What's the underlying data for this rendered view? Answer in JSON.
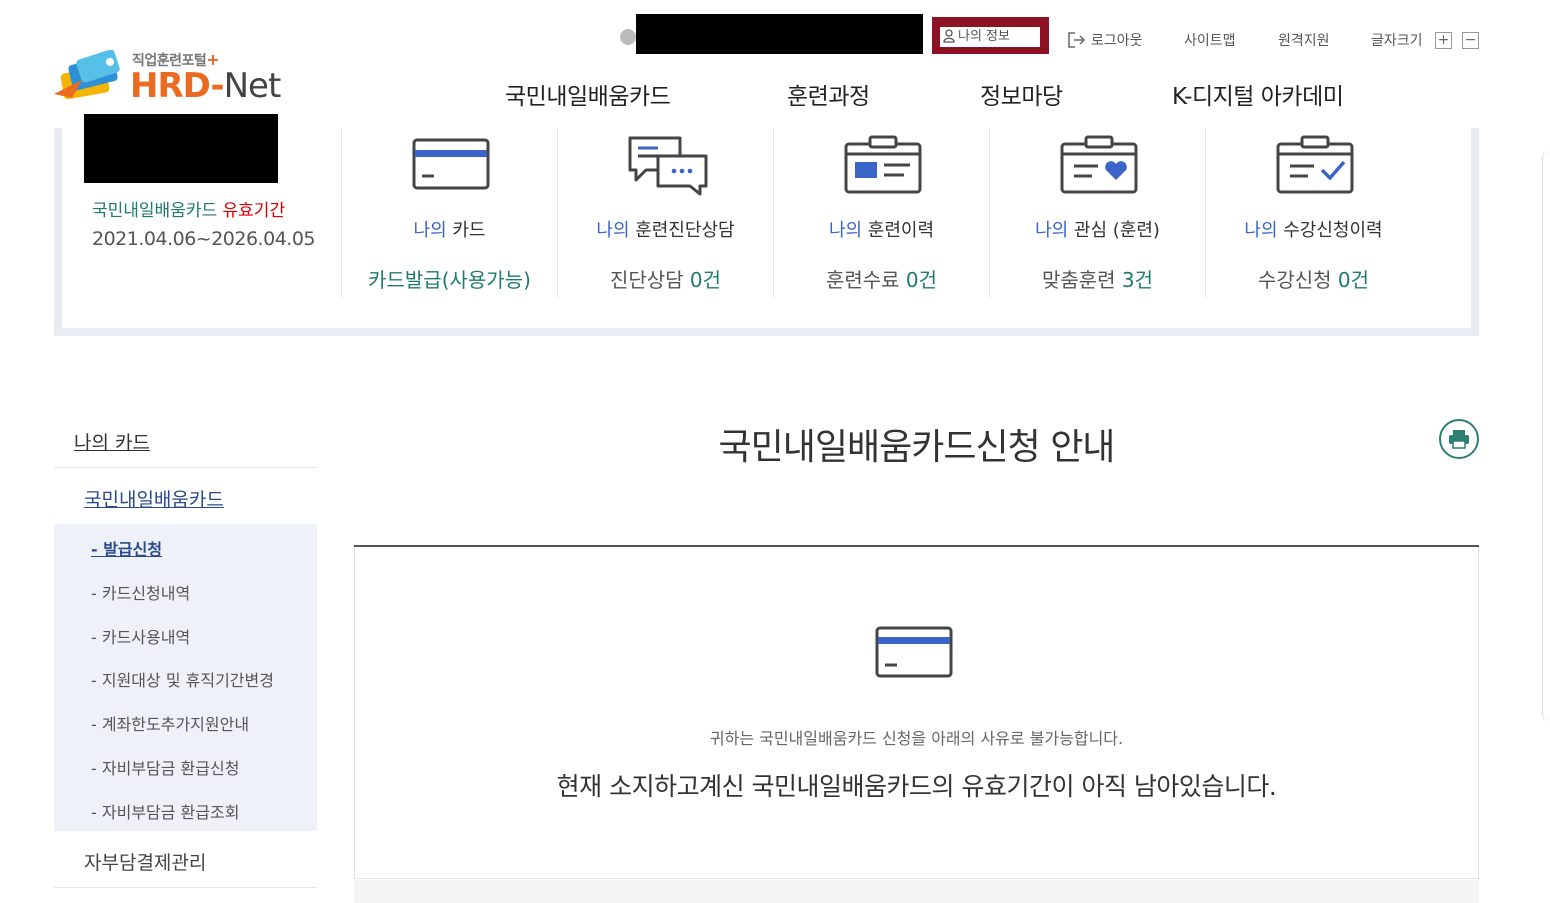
{
  "logo": {
    "sub_text": "직업훈련포털",
    "sub_plus": "+",
    "main_hrd": "HRD",
    "main_dash": "-",
    "main_net": "Net"
  },
  "util": {
    "my_info": "나의 정보",
    "logout": "로그아웃",
    "sitemap": "사이트맵",
    "remote": "원격지원",
    "font_size": "글자크기",
    "font_plus": "+",
    "font_minus": "−"
  },
  "gnb": [
    "국민내일배움카드",
    "훈련과정",
    "정보마당",
    "K-디지털 아카데미"
  ],
  "summary": {
    "validity_label_a": "국민내일배움카드 ",
    "validity_label_b": "유효기간",
    "validity_dates": "2021.04.06~2026.04.05",
    "columns": [
      {
        "my": "나의",
        "title": " 카드",
        "value": "카드발급(사용가능)",
        "icon": "credit-card-icon"
      },
      {
        "my": "나의",
        "title": " 훈련진단상담",
        "value_text": "진단상담 ",
        "value_num": "0건",
        "icon": "chat-bubbles-icon"
      },
      {
        "my": "나의",
        "title": " 훈련이력",
        "value_text": "훈련수료 ",
        "value_num": "0건",
        "icon": "id-card-icon"
      },
      {
        "my": "나의",
        "title": " 관심 (훈련)",
        "value_text": "맞춤훈련 ",
        "value_num": "3건",
        "icon": "heart-folder-icon"
      },
      {
        "my": "나의",
        "title": " 수강신청이력",
        "value_text": "수강신청 ",
        "value_num": "0건",
        "icon": "check-folder-icon"
      }
    ]
  },
  "sidebar": {
    "title": "나의 카드",
    "sub_title": "국민내일배움카드",
    "items": [
      "- 발급신청",
      "- 카드신청내역",
      "- 카드사용내역",
      "- 지원대상 및 휴직기간변경",
      "- 계좌한도추가지원안내",
      "- 자비부담금 환급신청",
      "- 자비부담금 환급조회"
    ],
    "bottom": "자부담결제관리"
  },
  "main": {
    "title": "국민내일배움카드신청 안내",
    "info_small": "귀하는 국민내일배움카드 신청을 아래의 사유로 불가능합니다.",
    "info_large": "현재 소지하고계신 국민내일배움카드의 유효기간이 아직 남아있습니다."
  },
  "colors": {
    "accent_teal": "#1f7a6e",
    "accent_blue": "#3a64c8",
    "my_info_border": "#8c1224",
    "logo_orange": "#ec6a1f"
  }
}
